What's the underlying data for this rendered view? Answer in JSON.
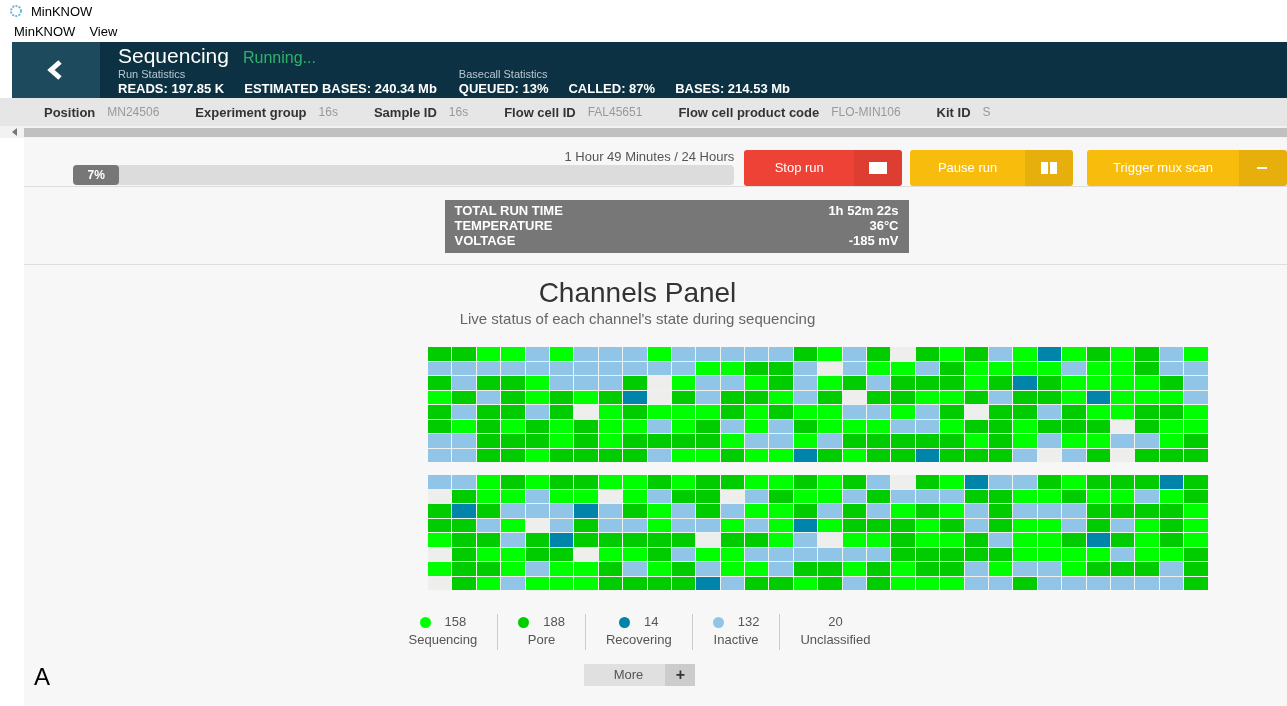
{
  "window": {
    "title": "MinKNOW"
  },
  "menu": [
    "MinKNOW",
    "View"
  ],
  "header": {
    "title": "Sequencing",
    "status": "Running...",
    "groups": [
      {
        "caption": "Run Statistics",
        "stats": [
          {
            "label": "READS:",
            "value": "197.85 K"
          },
          {
            "label": "ESTIMATED BASES:",
            "value": "240.34 Mb"
          }
        ]
      },
      {
        "caption": "Basecall Statistics",
        "stats": [
          {
            "label": "QUEUED:",
            "value": "13%"
          },
          {
            "label": "CALLED:",
            "value": "87%"
          },
          {
            "label": "BASES:",
            "value": "214.53 Mb"
          }
        ]
      }
    ]
  },
  "info_bar": [
    {
      "label": "Position",
      "value": "MN24506"
    },
    {
      "label": "Experiment group",
      "value": "16s"
    },
    {
      "label": "Sample ID",
      "value": "16s"
    },
    {
      "label": "Flow cell ID",
      "value": "FAL45651"
    },
    {
      "label": "Flow cell product code",
      "value": "FLO-MIN106"
    },
    {
      "label": "Kit ID",
      "value": "S"
    }
  ],
  "progress": {
    "time": "1 Hour 49 Minutes / 24 Hours",
    "percent": "7%",
    "level": 0.07
  },
  "buttons": [
    {
      "label": "Stop run",
      "kind": "stop"
    },
    {
      "label": "Pause run",
      "kind": "pause"
    },
    {
      "label": "Trigger mux scan",
      "kind": "mux"
    }
  ],
  "run_info": [
    {
      "label": "TOTAL RUN TIME",
      "value": "1h 52m 22s"
    },
    {
      "label": "TEMPERATURE",
      "value": "36°C"
    },
    {
      "label": "VOLTAGE",
      "value": "-185 mV"
    }
  ],
  "channels_panel": {
    "title": "Channels Panel",
    "subtitle": "Live status of each channel's state during sequencing",
    "blocks": [
      {
        "rows": [
          {
            "cells": [
              {
                "kind": "pore"
              },
              {
                "kind": "pore"
              },
              {
                "kind": "seq"
              },
              {
                "kind": "seq"
              },
              {
                "kind": "idle"
              },
              {
                "kind": "seq"
              },
              {
                "kind": "idle"
              },
              {
                "kind": "idle"
              },
              {
                "kind": "idle"
              },
              {
                "kind": "seq"
              },
              {
                "kind": "idle"
              },
              {
                "kind": "idle"
              },
              {
                "kind": "idle"
              },
              {
                "kind": "idle"
              },
              {
                "kind": "idle"
              },
              {
                "kind": "pore"
              },
              {
                "kind": "seq"
              },
              {
                "kind": "idle"
              },
              {
                "kind": "pore"
              },
              {
                "kind": "uncl"
              },
              {
                "kind": "pore"
              },
              {
                "kind": "seq"
              },
              {
                "kind": "pore"
              },
              {
                "kind": "idle"
              },
              {
                "kind": "seq"
              },
              {
                "kind": "rec"
              },
              {
                "kind": "seq"
              },
              {
                "kind": "pore"
              },
              {
                "kind": "seq"
              },
              {
                "kind": "pore"
              },
              {
                "kind": "idle"
              },
              {
                "kind": "seq"
              }
            ]
          },
          {
            "cells": [
              {
                "kind": "idle"
              },
              {
                "kind": "idle"
              },
              {
                "kind": "idle"
              },
              {
                "kind": "idle"
              },
              {
                "kind": "idle"
              },
              {
                "kind": "idle"
              },
              {
                "kind": "idle"
              },
              {
                "kind": "idle"
              },
              {
                "kind": "idle"
              },
              {
                "kind": "idle"
              },
              {
                "kind": "idle"
              },
              {
                "kind": "seq"
              },
              {
                "kind": "seq"
              },
              {
                "kind": "pore"
              },
              {
                "kind": "pore"
              },
              {
                "kind": "idle"
              },
              {
                "kind": "uncl"
              },
              {
                "kind": "idle"
              },
              {
                "kind": "seq"
              },
              {
                "kind": "seq"
              },
              {
                "kind": "idle"
              },
              {
                "kind": "pore"
              },
              {
                "kind": "seq"
              },
              {
                "kind": "seq"
              },
              {
                "kind": "seq"
              },
              {
                "kind": "seq"
              },
              {
                "kind": "idle"
              },
              {
                "kind": "seq"
              },
              {
                "kind": "seq"
              },
              {
                "kind": "pore"
              },
              {
                "kind": "idle"
              },
              {
                "kind": "idle"
              }
            ]
          },
          {
            "cells": [
              {
                "kind": "pore"
              },
              {
                "kind": "idle"
              },
              {
                "kind": "pore"
              },
              {
                "kind": "pore"
              },
              {
                "kind": "seq"
              },
              {
                "kind": "idle"
              },
              {
                "kind": "idle"
              },
              {
                "kind": "idle"
              },
              {
                "kind": "pore"
              },
              {
                "kind": "uncl"
              },
              {
                "kind": "seq"
              },
              {
                "kind": "idle"
              },
              {
                "kind": "idle"
              },
              {
                "kind": "seq"
              },
              {
                "kind": "pore"
              },
              {
                "kind": "idle"
              },
              {
                "kind": "seq"
              },
              {
                "kind": "pore"
              },
              {
                "kind": "idle"
              },
              {
                "kind": "pore"
              },
              {
                "kind": "pore"
              },
              {
                "kind": "pore"
              },
              {
                "kind": "seq"
              },
              {
                "kind": "pore"
              },
              {
                "kind": "rec"
              },
              {
                "kind": "pore"
              },
              {
                "kind": "seq"
              },
              {
                "kind": "seq"
              },
              {
                "kind": "seq"
              },
              {
                "kind": "seq"
              },
              {
                "kind": "pore"
              },
              {
                "kind": "idle"
              }
            ]
          },
          {
            "cells": [
              {
                "kind": "seq"
              },
              {
                "kind": "pore"
              },
              {
                "kind": "idle"
              },
              {
                "kind": "pore"
              },
              {
                "kind": "seq"
              },
              {
                "kind": "pore"
              },
              {
                "kind": "seq"
              },
              {
                "kind": "pore"
              },
              {
                "kind": "rec"
              },
              {
                "kind": "uncl"
              },
              {
                "kind": "pore"
              },
              {
                "kind": "idle"
              },
              {
                "kind": "pore"
              },
              {
                "kind": "pore"
              },
              {
                "kind": "seq"
              },
              {
                "kind": "idle"
              },
              {
                "kind": "pore"
              },
              {
                "kind": "uncl"
              },
              {
                "kind": "pore"
              },
              {
                "kind": "pore"
              },
              {
                "kind": "seq"
              },
              {
                "kind": "seq"
              },
              {
                "kind": "pore"
              },
              {
                "kind": "idle"
              },
              {
                "kind": "pore"
              },
              {
                "kind": "pore"
              },
              {
                "kind": "seq"
              },
              {
                "kind": "rec"
              },
              {
                "kind": "seq"
              },
              {
                "kind": "seq"
              },
              {
                "kind": "seq"
              },
              {
                "kind": "idle"
              }
            ]
          },
          {
            "cells": [
              {
                "kind": "pore"
              },
              {
                "kind": "idle"
              },
              {
                "kind": "pore"
              },
              {
                "kind": "pore"
              },
              {
                "kind": "idle"
              },
              {
                "kind": "pore"
              },
              {
                "kind": "uncl"
              },
              {
                "kind": "seq"
              },
              {
                "kind": "pore"
              },
              {
                "kind": "seq"
              },
              {
                "kind": "seq"
              },
              {
                "kind": "seq"
              },
              {
                "kind": "pore"
              },
              {
                "kind": "seq"
              },
              {
                "kind": "pore"
              },
              {
                "kind": "seq"
              },
              {
                "kind": "seq"
              },
              {
                "kind": "idle"
              },
              {
                "kind": "idle"
              },
              {
                "kind": "seq"
              },
              {
                "kind": "idle"
              },
              {
                "kind": "pore"
              },
              {
                "kind": "uncl"
              },
              {
                "kind": "pore"
              },
              {
                "kind": "pore"
              },
              {
                "kind": "idle"
              },
              {
                "kind": "pore"
              },
              {
                "kind": "seq"
              },
              {
                "kind": "seq"
              },
              {
                "kind": "pore"
              },
              {
                "kind": "pore"
              },
              {
                "kind": "seq"
              }
            ]
          },
          {
            "cells": [
              {
                "kind": "pore"
              },
              {
                "kind": "seq"
              },
              {
                "kind": "pore"
              },
              {
                "kind": "seq"
              },
              {
                "kind": "pore"
              },
              {
                "kind": "seq"
              },
              {
                "kind": "pore"
              },
              {
                "kind": "seq"
              },
              {
                "kind": "seq"
              },
              {
                "kind": "idle"
              },
              {
                "kind": "seq"
              },
              {
                "kind": "pore"
              },
              {
                "kind": "idle"
              },
              {
                "kind": "seq"
              },
              {
                "kind": "idle"
              },
              {
                "kind": "pore"
              },
              {
                "kind": "seq"
              },
              {
                "kind": "seq"
              },
              {
                "kind": "seq"
              },
              {
                "kind": "idle"
              },
              {
                "kind": "idle"
              },
              {
                "kind": "seq"
              },
              {
                "kind": "pore"
              },
              {
                "kind": "pore"
              },
              {
                "kind": "seq"
              },
              {
                "kind": "pore"
              },
              {
                "kind": "pore"
              },
              {
                "kind": "pore"
              },
              {
                "kind": "uncl"
              },
              {
                "kind": "pore"
              },
              {
                "kind": "seq"
              },
              {
                "kind": "seq"
              }
            ]
          },
          {
            "cells": [
              {
                "kind": "idle"
              },
              {
                "kind": "idle"
              },
              {
                "kind": "pore"
              },
              {
                "kind": "pore"
              },
              {
                "kind": "pore"
              },
              {
                "kind": "seq"
              },
              {
                "kind": "pore"
              },
              {
                "kind": "seq"
              },
              {
                "kind": "pore"
              },
              {
                "kind": "pore"
              },
              {
                "kind": "pore"
              },
              {
                "kind": "pore"
              },
              {
                "kind": "seq"
              },
              {
                "kind": "idle"
              },
              {
                "kind": "idle"
              },
              {
                "kind": "seq"
              },
              {
                "kind": "idle"
              },
              {
                "kind": "pore"
              },
              {
                "kind": "pore"
              },
              {
                "kind": "pore"
              },
              {
                "kind": "pore"
              },
              {
                "kind": "pore"
              },
              {
                "kind": "seq"
              },
              {
                "kind": "pore"
              },
              {
                "kind": "seq"
              },
              {
                "kind": "idle"
              },
              {
                "kind": "seq"
              },
              {
                "kind": "seq"
              },
              {
                "kind": "idle"
              },
              {
                "kind": "idle"
              },
              {
                "kind": "seq"
              },
              {
                "kind": "pore"
              }
            ]
          },
          {
            "cells": [
              {
                "kind": "idle"
              },
              {
                "kind": "idle"
              },
              {
                "kind": "pore"
              },
              {
                "kind": "pore"
              },
              {
                "kind": "seq"
              },
              {
                "kind": "pore"
              },
              {
                "kind": "pore"
              },
              {
                "kind": "pore"
              },
              {
                "kind": "pore"
              },
              {
                "kind": "idle"
              },
              {
                "kind": "seq"
              },
              {
                "kind": "seq"
              },
              {
                "kind": "pore"
              },
              {
                "kind": "seq"
              },
              {
                "kind": "seq"
              },
              {
                "kind": "rec"
              },
              {
                "kind": "pore"
              },
              {
                "kind": "seq"
              },
              {
                "kind": "pore"
              },
              {
                "kind": "pore"
              },
              {
                "kind": "rec"
              },
              {
                "kind": "pore"
              },
              {
                "kind": "pore"
              },
              {
                "kind": "pore"
              },
              {
                "kind": "idle"
              },
              {
                "kind": "uncl"
              },
              {
                "kind": "idle"
              },
              {
                "kind": "pore"
              },
              {
                "kind": "uncl"
              },
              {
                "kind": "pore"
              },
              {
                "kind": "pore"
              },
              {
                "kind": "pore"
              }
            ]
          }
        ]
      },
      {
        "rows": [
          {
            "cells": [
              {
                "kind": "idle"
              },
              {
                "kind": "idle"
              },
              {
                "kind": "seq"
              },
              {
                "kind": "pore"
              },
              {
                "kind": "seq"
              },
              {
                "kind": "pore"
              },
              {
                "kind": "pore"
              },
              {
                "kind": "seq"
              },
              {
                "kind": "seq"
              },
              {
                "kind": "pore"
              },
              {
                "kind": "seq"
              },
              {
                "kind": "pore"
              },
              {
                "kind": "pore"
              },
              {
                "kind": "seq"
              },
              {
                "kind": "seq"
              },
              {
                "kind": "pore"
              },
              {
                "kind": "seq"
              },
              {
                "kind": "pore"
              },
              {
                "kind": "idle"
              },
              {
                "kind": "uncl"
              },
              {
                "kind": "pore"
              },
              {
                "kind": "seq"
              },
              {
                "kind": "rec"
              },
              {
                "kind": "idle"
              },
              {
                "kind": "idle"
              },
              {
                "kind": "pore"
              },
              {
                "kind": "seq"
              },
              {
                "kind": "pore"
              },
              {
                "kind": "pore"
              },
              {
                "kind": "pore"
              },
              {
                "kind": "rec"
              },
              {
                "kind": "pore"
              }
            ]
          },
          {
            "cells": [
              {
                "kind": "uncl"
              },
              {
                "kind": "pore"
              },
              {
                "kind": "seq"
              },
              {
                "kind": "seq"
              },
              {
                "kind": "idle"
              },
              {
                "kind": "seq"
              },
              {
                "kind": "seq"
              },
              {
                "kind": "uncl"
              },
              {
                "kind": "seq"
              },
              {
                "kind": "idle"
              },
              {
                "kind": "pore"
              },
              {
                "kind": "pore"
              },
              {
                "kind": "uncl"
              },
              {
                "kind": "idle"
              },
              {
                "kind": "pore"
              },
              {
                "kind": "seq"
              },
              {
                "kind": "seq"
              },
              {
                "kind": "idle"
              },
              {
                "kind": "pore"
              },
              {
                "kind": "idle"
              },
              {
                "kind": "idle"
              },
              {
                "kind": "idle"
              },
              {
                "kind": "pore"
              },
              {
                "kind": "pore"
              },
              {
                "kind": "seq"
              },
              {
                "kind": "seq"
              },
              {
                "kind": "pore"
              },
              {
                "kind": "seq"
              },
              {
                "kind": "seq"
              },
              {
                "kind": "idle"
              },
              {
                "kind": "seq"
              },
              {
                "kind": "pore"
              }
            ]
          },
          {
            "cells": [
              {
                "kind": "pore"
              },
              {
                "kind": "rec"
              },
              {
                "kind": "pore"
              },
              {
                "kind": "idle"
              },
              {
                "kind": "idle"
              },
              {
                "kind": "idle"
              },
              {
                "kind": "rec"
              },
              {
                "kind": "idle"
              },
              {
                "kind": "pore"
              },
              {
                "kind": "seq"
              },
              {
                "kind": "idle"
              },
              {
                "kind": "pore"
              },
              {
                "kind": "idle"
              },
              {
                "kind": "seq"
              },
              {
                "kind": "seq"
              },
              {
                "kind": "pore"
              },
              {
                "kind": "idle"
              },
              {
                "kind": "pore"
              },
              {
                "kind": "idle"
              },
              {
                "kind": "seq"
              },
              {
                "kind": "pore"
              },
              {
                "kind": "seq"
              },
              {
                "kind": "idle"
              },
              {
                "kind": "pore"
              },
              {
                "kind": "idle"
              },
              {
                "kind": "idle"
              },
              {
                "kind": "idle"
              },
              {
                "kind": "pore"
              },
              {
                "kind": "pore"
              },
              {
                "kind": "pore"
              },
              {
                "kind": "pore"
              },
              {
                "kind": "seq"
              }
            ]
          },
          {
            "cells": [
              {
                "kind": "pore"
              },
              {
                "kind": "pore"
              },
              {
                "kind": "idle"
              },
              {
                "kind": "seq"
              },
              {
                "kind": "uncl"
              },
              {
                "kind": "idle"
              },
              {
                "kind": "pore"
              },
              {
                "kind": "idle"
              },
              {
                "kind": "idle"
              },
              {
                "kind": "seq"
              },
              {
                "kind": "idle"
              },
              {
                "kind": "idle"
              },
              {
                "kind": "seq"
              },
              {
                "kind": "idle"
              },
              {
                "kind": "seq"
              },
              {
                "kind": "rec"
              },
              {
                "kind": "seq"
              },
              {
                "kind": "pore"
              },
              {
                "kind": "pore"
              },
              {
                "kind": "pore"
              },
              {
                "kind": "seq"
              },
              {
                "kind": "pore"
              },
              {
                "kind": "idle"
              },
              {
                "kind": "pore"
              },
              {
                "kind": "seq"
              },
              {
                "kind": "seq"
              },
              {
                "kind": "idle"
              },
              {
                "kind": "pore"
              },
              {
                "kind": "idle"
              },
              {
                "kind": "seq"
              },
              {
                "kind": "pore"
              },
              {
                "kind": "seq"
              }
            ]
          },
          {
            "cells": [
              {
                "kind": "seq"
              },
              {
                "kind": "pore"
              },
              {
                "kind": "pore"
              },
              {
                "kind": "idle"
              },
              {
                "kind": "pore"
              },
              {
                "kind": "rec"
              },
              {
                "kind": "pore"
              },
              {
                "kind": "pore"
              },
              {
                "kind": "pore"
              },
              {
                "kind": "pore"
              },
              {
                "kind": "pore"
              },
              {
                "kind": "uncl"
              },
              {
                "kind": "pore"
              },
              {
                "kind": "pore"
              },
              {
                "kind": "seq"
              },
              {
                "kind": "idle"
              },
              {
                "kind": "uncl"
              },
              {
                "kind": "seq"
              },
              {
                "kind": "seq"
              },
              {
                "kind": "pore"
              },
              {
                "kind": "seq"
              },
              {
                "kind": "seq"
              },
              {
                "kind": "pore"
              },
              {
                "kind": "idle"
              },
              {
                "kind": "seq"
              },
              {
                "kind": "seq"
              },
              {
                "kind": "pore"
              },
              {
                "kind": "rec"
              },
              {
                "kind": "pore"
              },
              {
                "kind": "seq"
              },
              {
                "kind": "pore"
              },
              {
                "kind": "seq"
              }
            ]
          },
          {
            "cells": [
              {
                "kind": "uncl"
              },
              {
                "kind": "pore"
              },
              {
                "kind": "seq"
              },
              {
                "kind": "seq"
              },
              {
                "kind": "pore"
              },
              {
                "kind": "pore"
              },
              {
                "kind": "uncl"
              },
              {
                "kind": "seq"
              },
              {
                "kind": "seq"
              },
              {
                "kind": "pore"
              },
              {
                "kind": "idle"
              },
              {
                "kind": "seq"
              },
              {
                "kind": "seq"
              },
              {
                "kind": "idle"
              },
              {
                "kind": "idle"
              },
              {
                "kind": "idle"
              },
              {
                "kind": "idle"
              },
              {
                "kind": "idle"
              },
              {
                "kind": "idle"
              },
              {
                "kind": "pore"
              },
              {
                "kind": "pore"
              },
              {
                "kind": "pore"
              },
              {
                "kind": "pore"
              },
              {
                "kind": "pore"
              },
              {
                "kind": "seq"
              },
              {
                "kind": "seq"
              },
              {
                "kind": "seq"
              },
              {
                "kind": "seq"
              },
              {
                "kind": "idle"
              },
              {
                "kind": "seq"
              },
              {
                "kind": "seq"
              },
              {
                "kind": "pore"
              }
            ]
          },
          {
            "cells": [
              {
                "kind": "seq"
              },
              {
                "kind": "pore"
              },
              {
                "kind": "pore"
              },
              {
                "kind": "seq"
              },
              {
                "kind": "idle"
              },
              {
                "kind": "seq"
              },
              {
                "kind": "seq"
              },
              {
                "kind": "pore"
              },
              {
                "kind": "idle"
              },
              {
                "kind": "seq"
              },
              {
                "kind": "pore"
              },
              {
                "kind": "idle"
              },
              {
                "kind": "seq"
              },
              {
                "kind": "seq"
              },
              {
                "kind": "idle"
              },
              {
                "kind": "pore"
              },
              {
                "kind": "pore"
              },
              {
                "kind": "seq"
              },
              {
                "kind": "pore"
              },
              {
                "kind": "seq"
              },
              {
                "kind": "pore"
              },
              {
                "kind": "pore"
              },
              {
                "kind": "idle"
              },
              {
                "kind": "seq"
              },
              {
                "kind": "idle"
              },
              {
                "kind": "idle"
              },
              {
                "kind": "seq"
              },
              {
                "kind": "pore"
              },
              {
                "kind": "pore"
              },
              {
                "kind": "pore"
              },
              {
                "kind": "idle"
              },
              {
                "kind": "pore"
              }
            ]
          },
          {
            "cells": [
              {
                "kind": "uncl"
              },
              {
                "kind": "pore"
              },
              {
                "kind": "seq"
              },
              {
                "kind": "idle"
              },
              {
                "kind": "seq"
              },
              {
                "kind": "seq"
              },
              {
                "kind": "seq"
              },
              {
                "kind": "pore"
              },
              {
                "kind": "pore"
              },
              {
                "kind": "pore"
              },
              {
                "kind": "pore"
              },
              {
                "kind": "rec"
              },
              {
                "kind": "idle"
              },
              {
                "kind": "pore"
              },
              {
                "kind": "pore"
              },
              {
                "kind": "seq"
              },
              {
                "kind": "pore"
              },
              {
                "kind": "idle"
              },
              {
                "kind": "pore"
              },
              {
                "kind": "seq"
              },
              {
                "kind": "seq"
              },
              {
                "kind": "seq"
              },
              {
                "kind": "idle"
              },
              {
                "kind": "idle"
              },
              {
                "kind": "pore"
              },
              {
                "kind": "idle"
              },
              {
                "kind": "idle"
              },
              {
                "kind": "idle"
              },
              {
                "kind": "idle"
              },
              {
                "kind": "idle"
              },
              {
                "kind": "idle"
              },
              {
                "kind": "pore"
              }
            ]
          }
        ]
      }
    ],
    "legend": [
      {
        "kind": "seq",
        "count": "158",
        "label": "Sequencing",
        "color": "#00ff00"
      },
      {
        "kind": "pore",
        "count": "188",
        "label": "Pore",
        "color": "#00cc00"
      },
      {
        "kind": "rec",
        "count": "14",
        "label": "Recovering",
        "color": "#0084a9"
      },
      {
        "kind": "idle",
        "count": "132",
        "label": "Inactive",
        "color": "#90c5e8"
      },
      {
        "kind": "uncl",
        "count": "20",
        "label": "Unclassified"
      }
    ],
    "more": {
      "label": "More",
      "icon": "+"
    }
  },
  "figure_label": "A"
}
